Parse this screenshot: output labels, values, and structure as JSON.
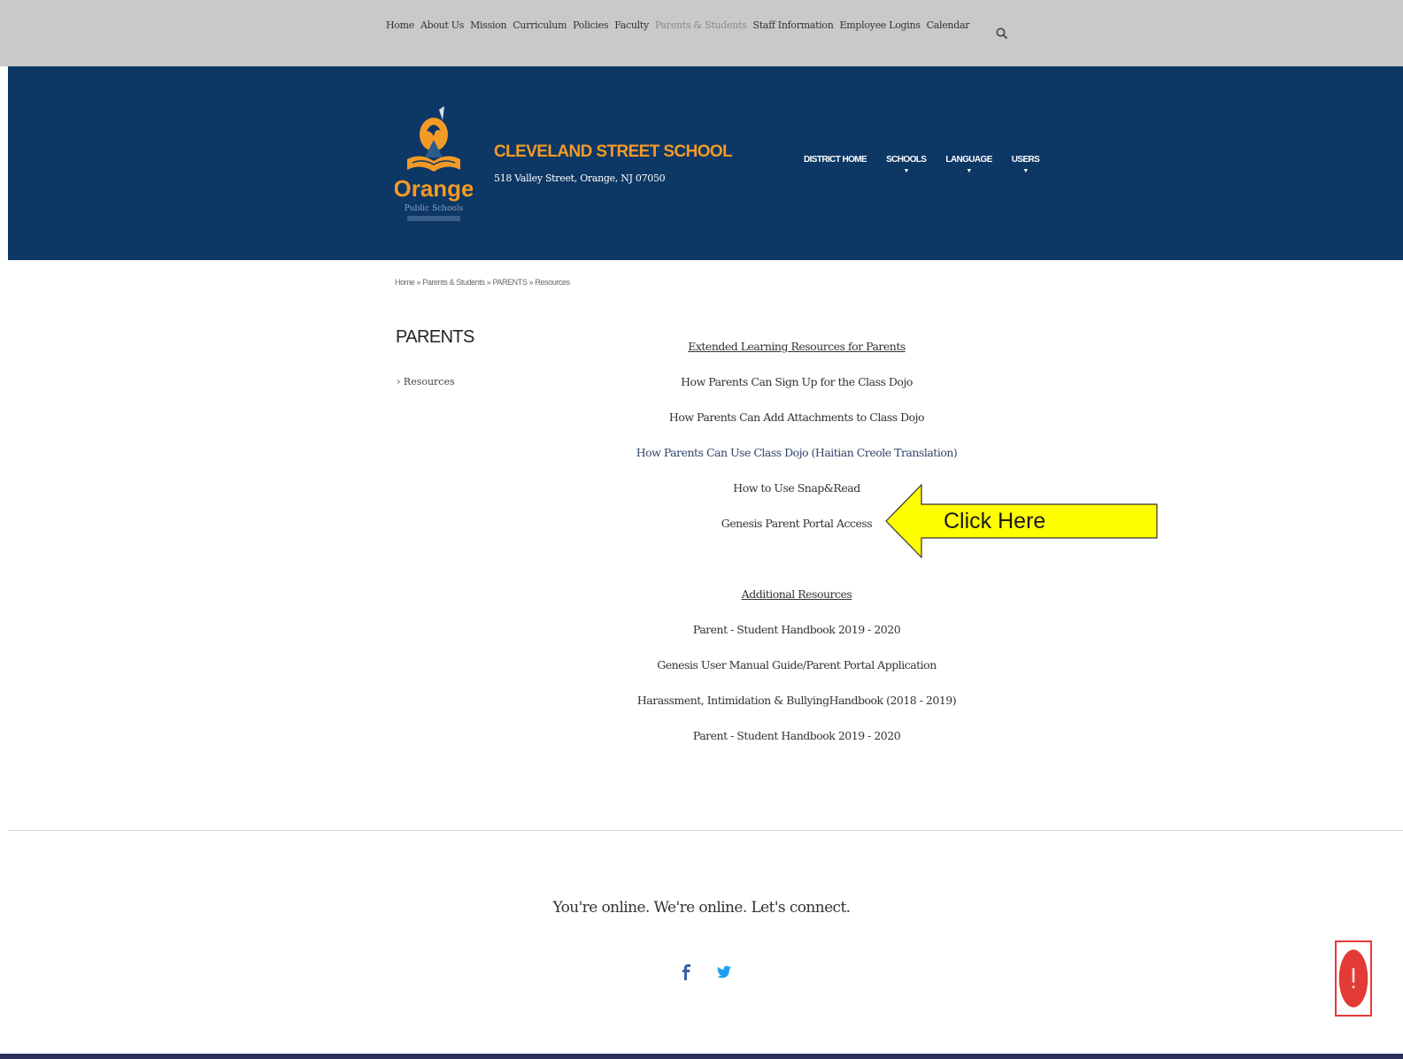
{
  "top_nav": {
    "items": [
      "Home",
      "About Us",
      "Mission",
      "Curriculum",
      "Policies",
      "Faculty",
      "Parents & Students",
      "Staff Information",
      "Employee Logins",
      "Calendar"
    ],
    "active_index": 6
  },
  "header": {
    "school_name": "CLEVELAND STREET SCHOOL",
    "address": "518 Valley Street, Orange, NJ 07050",
    "logo": {
      "wordmark": "Orange",
      "subtitle": "Public Schools"
    },
    "nav": [
      {
        "label": "DISTRICT HOME",
        "caret": ""
      },
      {
        "label": "SCHOOLS",
        "caret": "▼"
      },
      {
        "label": "LANGUAGE",
        "caret": "▼"
      },
      {
        "label": "USERS",
        "caret": "▼"
      }
    ]
  },
  "breadcrumb": [
    "Home",
    "Parents & Students",
    "PARENTS",
    "Resources"
  ],
  "breadcrumb_separator": "»",
  "sidebar": {
    "title": "PARENTS",
    "items": [
      {
        "marker": "›",
        "label": "Resources"
      }
    ]
  },
  "content": {
    "section1": {
      "heading": "Extended Learning Resources for Parents",
      "links": [
        "How Parents Can Sign Up for the Class Dojo",
        "How Parents Can Add Attachments to Class Dojo",
        "How Parents Can Use Class Dojo (Haitian Creole Translation)",
        "How to Use Snap&Read",
        "Genesis Parent Portal Access"
      ]
    },
    "section2": {
      "heading": "Additional Resources",
      "links": [
        "Parent - Student Handbook 2019 - 2020",
        "Genesis User Manual Guide/Parent Portal Application",
        "Harassment, Intimidation & BullyingHandbook  (2018 - 2019)",
        "Parent - Student Handbook 2019 - 2020"
      ]
    }
  },
  "callout": {
    "label": "Click Here",
    "fill": "#ffff00"
  },
  "footer": {
    "tagline": "You're online. We're online. Let's connect.",
    "social": [
      "facebook-icon",
      "twitter-icon"
    ]
  },
  "colors": {
    "header_bg": "#0d3764",
    "brand_orange": "#f39a26",
    "topbar_bg": "#c9c9c9",
    "alert_red": "#e23b35"
  }
}
